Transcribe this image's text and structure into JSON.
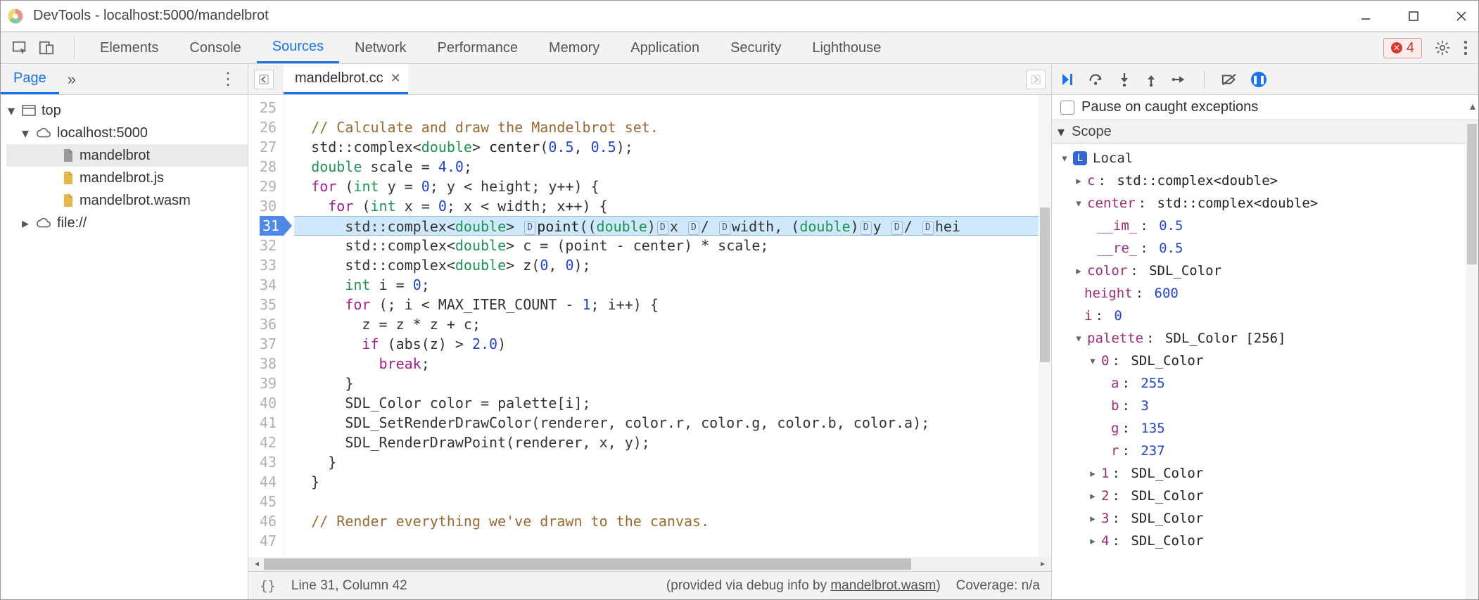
{
  "window": {
    "title": "DevTools - localhost:5000/mandelbrot"
  },
  "tabs": {
    "items": [
      "Elements",
      "Console",
      "Sources",
      "Network",
      "Performance",
      "Memory",
      "Application",
      "Security",
      "Lighthouse"
    ],
    "active_index": 2
  },
  "error_badge": {
    "count": "4"
  },
  "file_tree": {
    "page_tab": "Page",
    "top": "top",
    "origin": "localhost:5000",
    "files": [
      "mandelbrot",
      "mandelbrot.js",
      "mandelbrot.wasm"
    ],
    "selected_index": 0,
    "file_origin": "file://"
  },
  "editor": {
    "filename": "mandelbrot.cc",
    "first_line_no": 25,
    "current_line_no": 31,
    "lines": [
      {
        "n": 25,
        "html": ""
      },
      {
        "n": 26,
        "html": "  <span class='tok-comment'>// Calculate and draw the Mandelbrot set.</span>"
      },
      {
        "n": 27,
        "html": "  std::complex&lt;<span class='tok-type'>double</span>&gt; <span class='tok-fn'>center</span>(<span class='tok-num'>0.5</span>, <span class='tok-num'>0.5</span>);"
      },
      {
        "n": 28,
        "html": "  <span class='tok-type'>double</span> scale = <span class='tok-num'>4.0</span>;"
      },
      {
        "n": 29,
        "html": "  <span class='tok-kw'>for</span> (<span class='tok-type'>int</span> y = <span class='tok-num'>0</span>; y &lt; height; y++) {"
      },
      {
        "n": 30,
        "html": "    <span class='tok-kw'>for</span> (<span class='tok-type'>int</span> x = <span class='tok-num'>0</span>; x &lt; width; x++) {"
      },
      {
        "n": 31,
        "html": "      std::complex&lt;<span class='tok-type'>double</span>&gt; <span class='inline-hint'>D</span><span class='tok-fn'>point</span>((<span class='tok-type'>double</span>)<span class='inline-hint'>D</span>x <span class='inline-hint'>D</span>/ <span class='inline-hint'>D</span>width, (<span class='tok-type'>double</span>)<span class='inline-hint'>D</span>y <span class='inline-hint'>D</span>/ <span class='inline-hint'>D</span>hei"
      },
      {
        "n": 32,
        "html": "      std::complex&lt;<span class='tok-type'>double</span>&gt; c = (point - center) * scale;"
      },
      {
        "n": 33,
        "html": "      std::complex&lt;<span class='tok-type'>double</span>&gt; <span class='tok-fn'>z</span>(<span class='tok-num'>0</span>, <span class='tok-num'>0</span>);"
      },
      {
        "n": 34,
        "html": "      <span class='tok-type'>int</span> i = <span class='tok-num'>0</span>;"
      },
      {
        "n": 35,
        "html": "      <span class='tok-kw'>for</span> (; i &lt; MAX_ITER_COUNT - <span class='tok-num'>1</span>; i++) {"
      },
      {
        "n": 36,
        "html": "        z = z * z + c;"
      },
      {
        "n": 37,
        "html": "        <span class='tok-kw'>if</span> (abs(z) &gt; <span class='tok-num'>2.0</span>)"
      },
      {
        "n": 38,
        "html": "          <span class='tok-kw'>break</span>;"
      },
      {
        "n": 39,
        "html": "      }"
      },
      {
        "n": 40,
        "html": "      SDL_Color color = palette[i];"
      },
      {
        "n": 41,
        "html": "      SDL_SetRenderDrawColor(renderer, color.r, color.g, color.b, color.a);"
      },
      {
        "n": 42,
        "html": "      SDL_RenderDrawPoint(renderer, x, y);"
      },
      {
        "n": 43,
        "html": "    }"
      },
      {
        "n": 44,
        "html": "  }"
      },
      {
        "n": 45,
        "html": ""
      },
      {
        "n": 46,
        "html": "  <span class='tok-comment'>// Render everything we've drawn to the canvas.</span>"
      },
      {
        "n": 47,
        "html": ""
      }
    ]
  },
  "statusbar": {
    "pos": "Line 31, Column 42",
    "provided_prefix": "(provided via debug info by ",
    "provided_link": "mandelbrot.wasm",
    "provided_suffix": ")",
    "coverage": "Coverage: n/a"
  },
  "debugger": {
    "pause_caught": "Pause on caught exceptions",
    "scope_label": "Scope",
    "local_label": "Local",
    "vars": {
      "c": "std::complex<double>",
      "center": {
        "type": "std::complex<double>",
        "__im_": "0.5",
        "__re_": "0.5"
      },
      "color": "SDL_Color",
      "height": "600",
      "i": "0",
      "palette": {
        "type": "SDL_Color [256]",
        "items": {
          "0": {
            "type": "SDL_Color",
            "a": "255",
            "b": "3",
            "g": "135",
            "r": "237"
          },
          "1": "SDL_Color",
          "2": "SDL_Color",
          "3": "SDL_Color",
          "4": "SDL_Color"
        }
      }
    }
  }
}
